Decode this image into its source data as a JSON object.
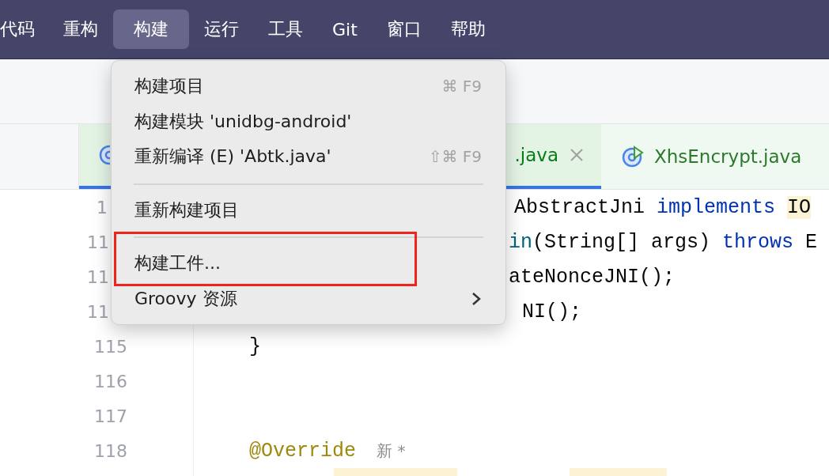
{
  "menu_bar": [
    {
      "label": "代码",
      "selected": false
    },
    {
      "label": "重构",
      "selected": false
    },
    {
      "label": "构建",
      "selected": true
    },
    {
      "label": "运行",
      "selected": false
    },
    {
      "label": "工具",
      "selected": false
    },
    {
      "label": "Git",
      "selected": false
    },
    {
      "label": "窗口",
      "selected": false
    },
    {
      "label": "帮助",
      "selected": false
    }
  ],
  "tabs": [
    {
      "label": ".java",
      "selected": true,
      "closable": true
    },
    {
      "label": "XhsEncrypt.java",
      "selected": false,
      "closable": false
    }
  ],
  "code_lines": [
    {
      "number": "1",
      "spans": [
        {
          "kind": "plain",
          "text": "AbstractJni "
        },
        {
          "kind": "keyword",
          "text": "implements"
        },
        {
          "kind": "usage",
          "text": "IO"
        }
      ]
    },
    {
      "number": "11",
      "spans": [
        {
          "kind": "method",
          "text": "in"
        },
        {
          "kind": "plain",
          "text": "(String[] args) "
        },
        {
          "kind": "keyword",
          "text": "throws"
        },
        {
          "kind": "plain",
          "text": " E"
        }
      ]
    },
    {
      "number": "11",
      "spans": [
        {
          "kind": "plain",
          "text": "ateNonceJNI();"
        }
      ]
    },
    {
      "number": "11",
      "spans": [
        {
          "kind": "plain",
          "text": "NI();"
        }
      ]
    },
    {
      "number": "115",
      "spans": [
        {
          "kind": "plain",
          "text": "}"
        }
      ]
    },
    {
      "number": "116"
    },
    {
      "number": "117"
    },
    {
      "number": "118",
      "spans": [
        {
          "kind": "annotation",
          "text": "@Override"
        },
        {
          "kind": "hint",
          "text": "新 *"
        }
      ]
    },
    {
      "spans": [
        {
          "kind": "occurrence"
        },
        {
          "kind": "occurrence"
        }
      ]
    }
  ],
  "build_menu": [
    {
      "kind": "item",
      "label": "构建项目",
      "shortcut": "⌘ F9",
      "boxed": false
    },
    {
      "kind": "item",
      "label": "构建模块 'unidbg-android'",
      "boxed": false
    },
    {
      "kind": "item",
      "label": "重新编译 (E) 'Abtk.java'",
      "shortcut": "⇧⌘ F9",
      "boxed": false
    },
    {
      "kind": "separator"
    },
    {
      "kind": "item",
      "label": "重新构建项目",
      "boxed": false
    },
    {
      "kind": "separator"
    },
    {
      "kind": "item",
      "label": "构建工件...",
      "boxed": true
    },
    {
      "kind": "submenu",
      "label": "Groovy 资源",
      "boxed": false
    }
  ]
}
